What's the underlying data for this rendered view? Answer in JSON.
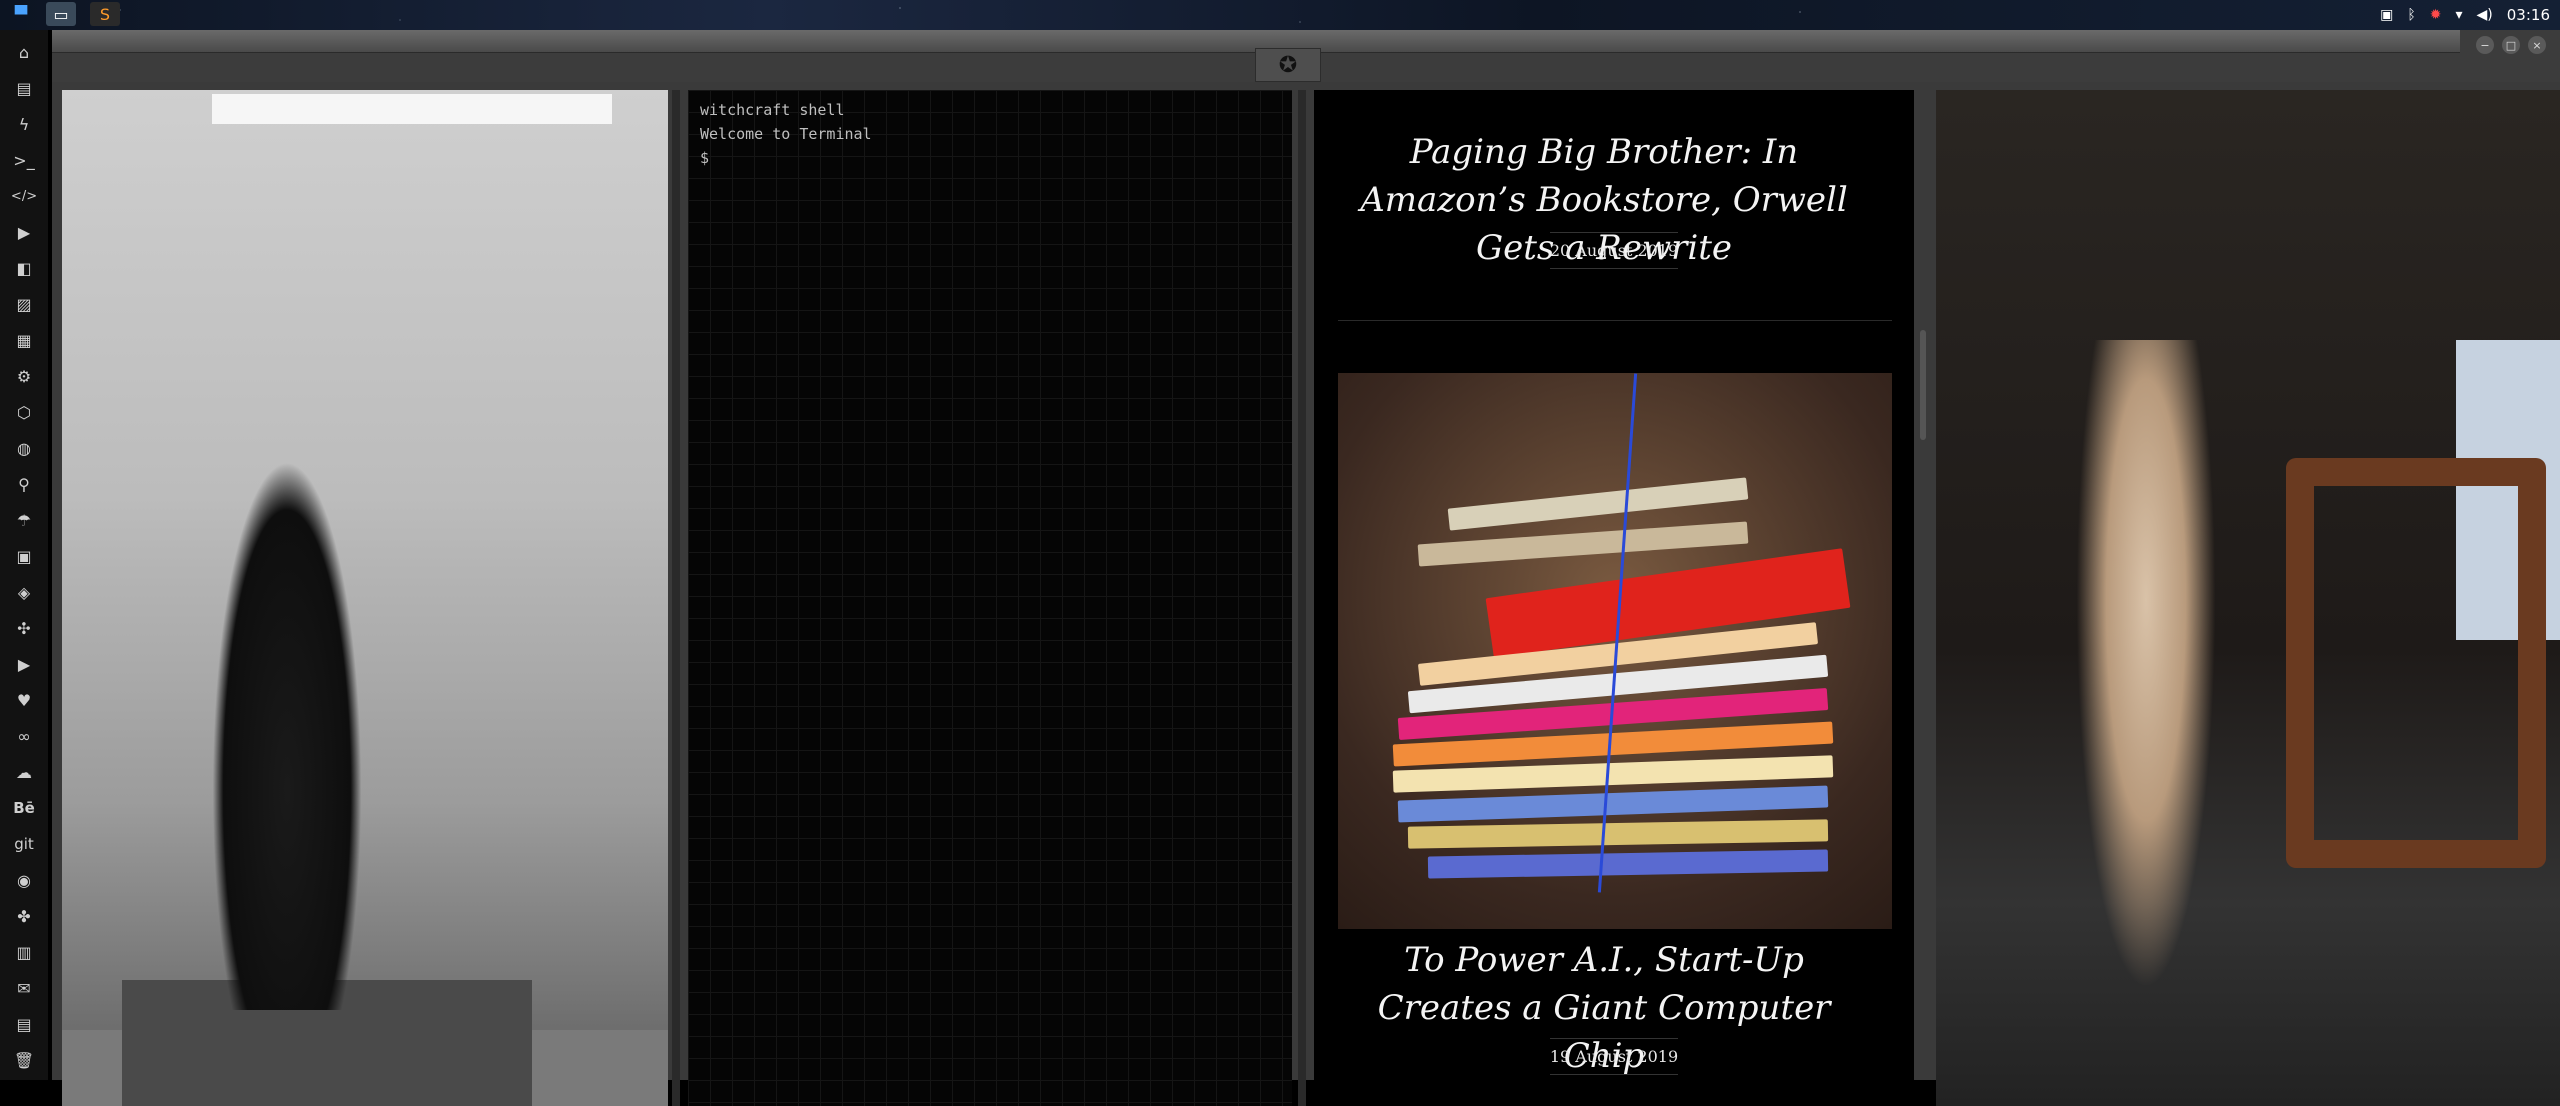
{
  "topbar": {
    "apps": [
      "folder-icon",
      "window-icon",
      "sublime-icon"
    ],
    "clock": "03:16",
    "tray_icons": [
      "screenshot-icon",
      "bluetooth-icon",
      "bug-icon",
      "wifi-icon",
      "volume-icon"
    ]
  },
  "dock": {
    "items": [
      "home-icon",
      "document-icon",
      "bolt-icon",
      "terminal-icon",
      "code-icon",
      "play-icon",
      "media-icon",
      "image-icon",
      "news-icon",
      "settings-icon",
      "hex-icon",
      "globe-icon",
      "search-icon",
      "umbrella-icon",
      "contact-icon",
      "shapes-icon",
      "expand-icon",
      "youtube-icon",
      "heart-icon",
      "infinity-icon",
      "cloud-icon",
      "behance-icon",
      "git-icon",
      "github-icon",
      "puzzle-icon",
      "map-icon",
      "mail-icon",
      "server-icon",
      "trash-icon"
    ],
    "behance_label": "Bē",
    "git_label": "git"
  },
  "terminal": {
    "line1": "witchcraft shell",
    "line2": "Welcome to Terminal",
    "prompt": "$"
  },
  "articles": [
    {
      "title": "Paging Big Brother: In Amazon’s Bookstore, Orwell Gets a Rewrite",
      "date": "20 August 2019"
    },
    {
      "title": "To Power A.I., Start-Up Creates a Giant Computer Chip",
      "date": "19 August 2019"
    }
  ],
  "colors": {
    "accent_bg": "#000000",
    "frame": "#3a3a3a",
    "dock": "#121212"
  }
}
